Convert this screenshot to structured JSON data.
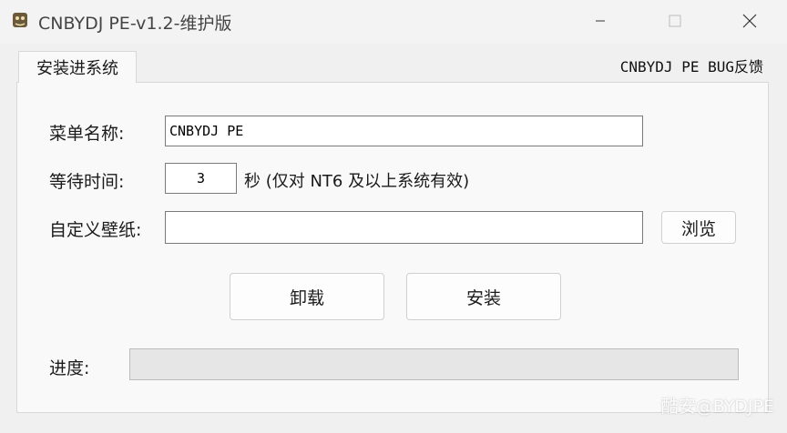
{
  "window": {
    "title": "CNBYDJ PE-v1.2-维护版",
    "controls": {
      "minimize": "minimize-icon",
      "maximize": "maximize-icon",
      "close": "close-icon"
    }
  },
  "tab": {
    "label": "安装进系统"
  },
  "bug_link": "CNBYDJ PE BUG反馈",
  "form": {
    "menu_name_label": "菜单名称:",
    "menu_name_value": "CNBYDJ PE",
    "wait_time_label": "等待时间:",
    "wait_time_value": "3",
    "wait_time_note": "秒 (仅对 NT6 及以上系统有效)",
    "wallpaper_label": "自定义壁纸:",
    "wallpaper_value": "",
    "browse_label": "浏览"
  },
  "actions": {
    "uninstall_label": "卸载",
    "install_label": "安装"
  },
  "progress": {
    "label": "进度:",
    "value": 0
  },
  "watermark": "酷安@BYDJPE",
  "colors": {
    "window_bg": "#f0f0f0",
    "panel_bg": "#f9f9f9",
    "progress_fill": "#06b025"
  }
}
